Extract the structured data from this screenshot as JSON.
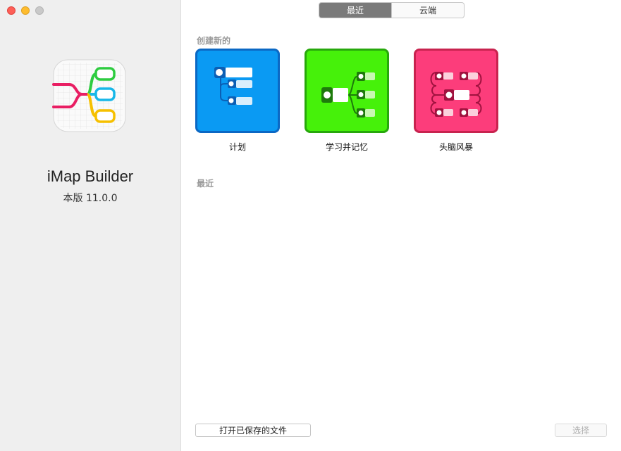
{
  "window": {
    "buttons": [
      "close",
      "minimize",
      "maximize"
    ]
  },
  "sidebar": {
    "app_name": "iMap Builder",
    "version": "本版 11.0.0",
    "icon": "mind-map-app-icon"
  },
  "tabs": [
    {
      "label": "最近",
      "active": true
    },
    {
      "label": "云端",
      "active": false
    }
  ],
  "create_section": {
    "title": "创建新的",
    "templates": [
      {
        "label": "计划",
        "icon": "plan-template-icon",
        "color": "#0a9af3"
      },
      {
        "label": "学习并记忆",
        "icon": "learn-template-icon",
        "color": "#46f10a"
      },
      {
        "label": "头脑风暴",
        "icon": "brainstorm-template-icon",
        "color": "#fc3d7b"
      }
    ]
  },
  "recent_section": {
    "title": "最近"
  },
  "footer": {
    "open_saved_label": "打开已保存的文件",
    "select_label": "选择"
  }
}
